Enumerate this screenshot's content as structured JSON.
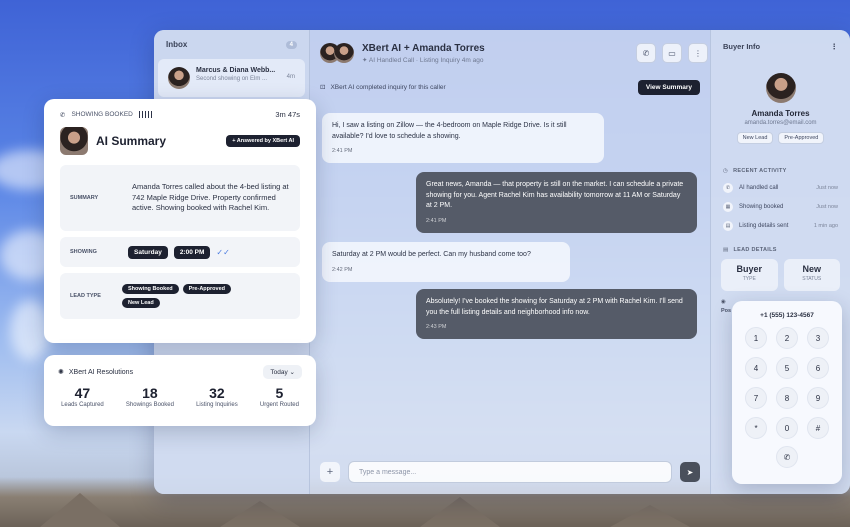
{
  "inbox": {
    "title": "Inbox",
    "count": "4",
    "items": [
      {
        "name": "Marcus & Diana Webb...",
        "preview": "Second showing on Elm ...",
        "time": "4m"
      }
    ]
  },
  "chat": {
    "title": "XBert AI + Amanda Torres",
    "subtitle": "AI Handled Call · Listing Inquiry 4m ago",
    "inquiry_text": "XBert AI completed inquiry for this caller",
    "view_summary_label": "View Summary",
    "messages": [
      {
        "text": "Hi, I saw a listing on Zillow — the 4-bedroom on Maple Ridge Drive. Is it still available? I'd love to schedule a showing.",
        "time": "2:41 PM"
      },
      {
        "text": "Great news, Amanda — that property is still on the market. I can schedule a private showing for you. Agent Rachel Kim has availability tomorrow at 11 AM or Saturday at 2 PM.",
        "time": "2:41 PM"
      },
      {
        "text": "Saturday at 2 PM would be perfect. Can my husband come too?",
        "time": "2:42 PM"
      },
      {
        "text": "Absolutely! I've booked the showing for Saturday at 2 PM with Rachel Kim. I'll send you the full listing details and neighborhood info now.",
        "time": "2:43 PM"
      }
    ],
    "input_placeholder": "Type a message..."
  },
  "buyer": {
    "header": "Buyer Info",
    "name": "Amanda Torres",
    "email": "amanda.torres@email.com",
    "tags": [
      "New Lead",
      "Pre-Approved"
    ],
    "recent_activity_label": "RECENT ACTIVITY",
    "activity": [
      {
        "label": "AI handled call",
        "time": "Just now"
      },
      {
        "label": "Showing booked",
        "time": "Just now"
      },
      {
        "label": "Listing details sent",
        "time": "1 min ago"
      }
    ],
    "lead_details_label": "LEAD DETAILS",
    "lead_boxes": [
      {
        "value": "Buyer",
        "label": "TYPE"
      },
      {
        "value": "New",
        "label": "STATUS"
      }
    ],
    "partial_label": "Pos"
  },
  "keypad": {
    "number": "+1 (555) 123-4567",
    "keys": [
      "1",
      "2",
      "3",
      "4",
      "5",
      "6",
      "7",
      "8",
      "9",
      "*",
      "0",
      "#"
    ]
  },
  "summary_card": {
    "status_label": "SHOWING BOOKED",
    "duration": "3m 47s",
    "title": "AI Summary",
    "answered_badge": "+ Answered by XBert AI",
    "summary_label": "SUMMARY",
    "summary_text": "Amanda Torres called about the 4-bed listing at 742 Maple Ridge Drive. Property confirmed active. Showing booked with Rachel Kim.",
    "showing_label": "SHOWING",
    "showing_day": "Saturday",
    "showing_time": "2:00 PM",
    "lead_type_label": "LEAD TYPE",
    "lead_types": [
      "Showing Booked",
      "Pre-Approved",
      "New Lead"
    ]
  },
  "resolutions": {
    "title": "XBert AI Resolutions",
    "period": "Today",
    "stats": [
      {
        "value": "47",
        "label": "Leads Captured"
      },
      {
        "value": "18",
        "label": "Showings Booked"
      },
      {
        "value": "32",
        "label": "Listing Inquiries"
      },
      {
        "value": "5",
        "label": "Urgent Routed"
      }
    ]
  },
  "colors": {
    "accent_dark": "#1d2130",
    "check_blue": "#4a7be0",
    "outgoing_bubble": "#555b68"
  }
}
